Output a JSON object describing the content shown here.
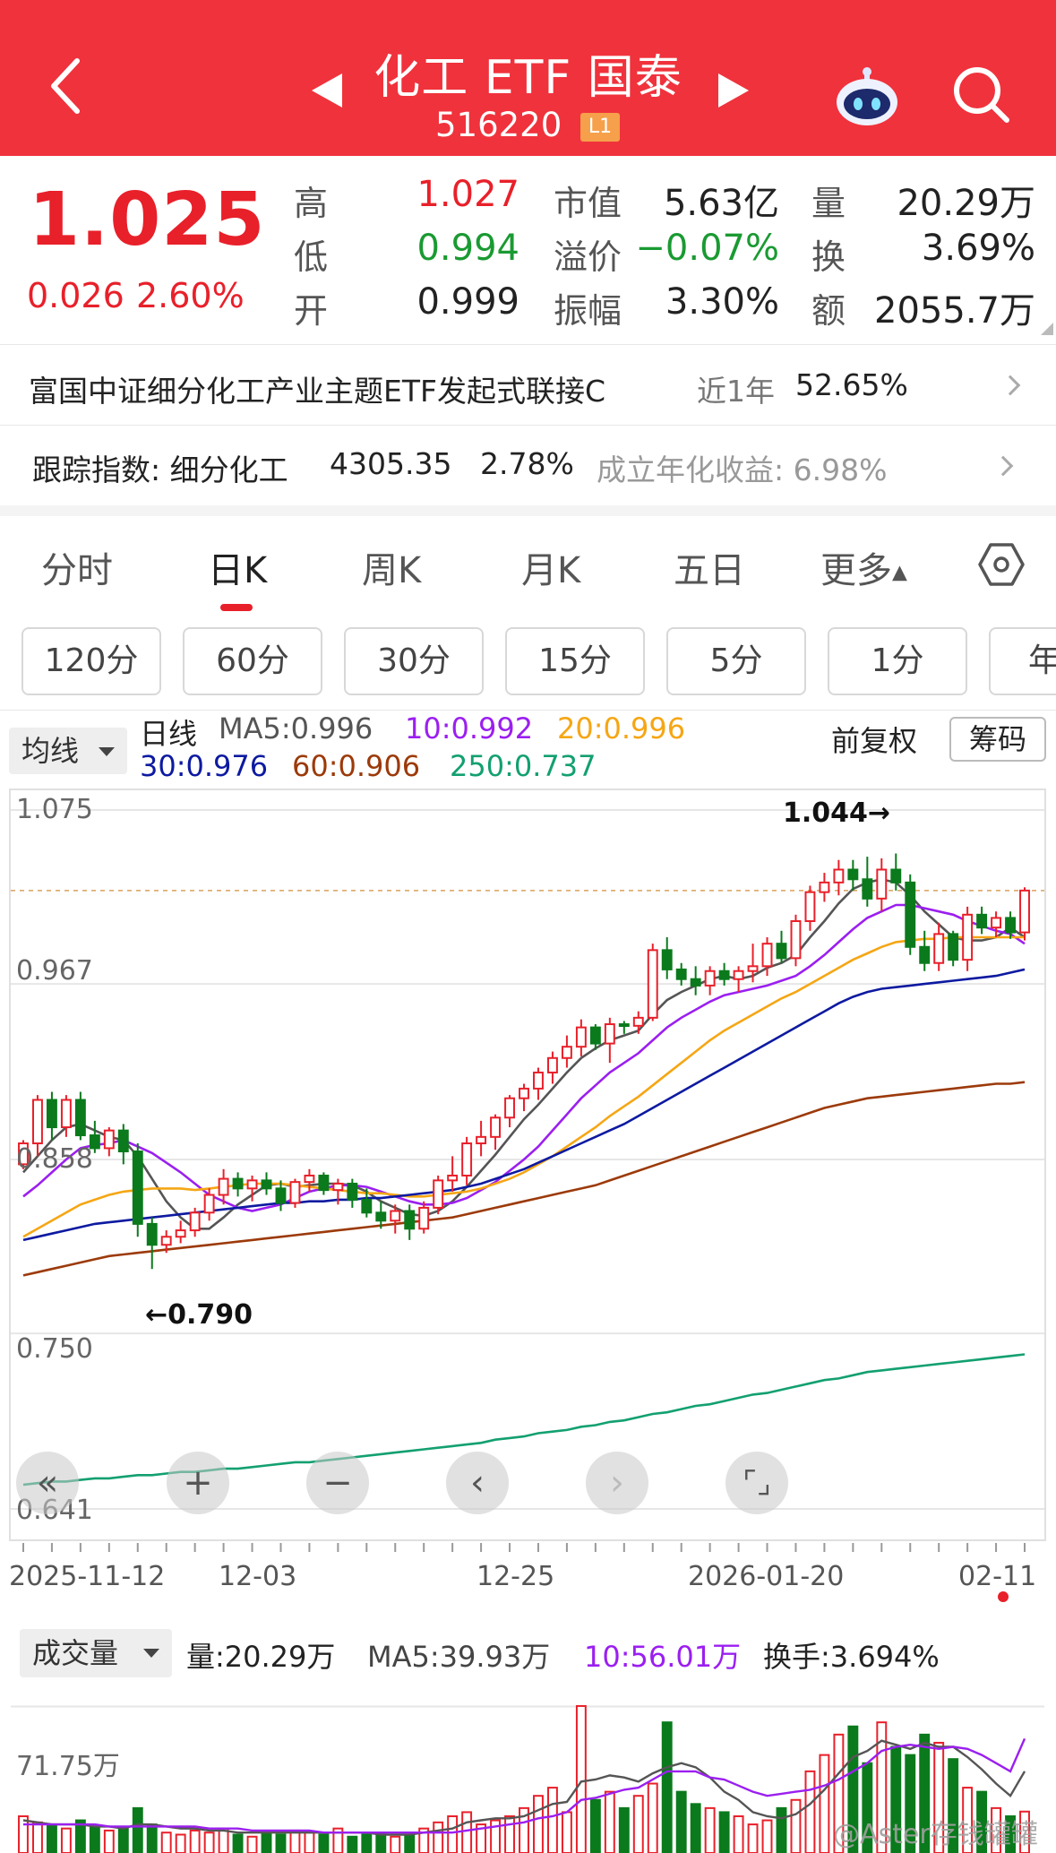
{
  "header": {
    "title": "化工 ETF 国泰",
    "code": "516220",
    "badge": "L1"
  },
  "quote": {
    "price": "1.025",
    "change": "0.026",
    "change_pct": "2.60%",
    "rows": [
      {
        "l1": "高",
        "v1": "1.027",
        "l2": "市值",
        "v2": "5.63亿",
        "l3": "量",
        "v3": "20.29万"
      },
      {
        "l1": "低",
        "v1": "0.994",
        "l2": "溢价",
        "v2": "−0.07%",
        "l3": "换",
        "v3": "3.69%"
      },
      {
        "l1": "开",
        "v1": "0.999",
        "l2": "振幅",
        "v2": "3.30%",
        "l3": "额",
        "v3": "2055.7万"
      }
    ]
  },
  "link_fund": {
    "name": "富国中证细分化工产业主题ETF发起式联接C",
    "period_label": "近1年",
    "period_return": "52.65%"
  },
  "tracking": {
    "label": "跟踪指数: 细分化工",
    "index_value": "4305.35",
    "index_pct": "2.78%",
    "annual_label": "成立年化收益: 6.98%"
  },
  "tabs": [
    "分时",
    "日K",
    "周K",
    "月K",
    "五日",
    "更多"
  ],
  "intervals": [
    "120分",
    "60分",
    "30分",
    "15分",
    "5分",
    "1分",
    "年"
  ],
  "ma_legend": {
    "dropdown": "均线",
    "line_label": "日线",
    "ma5": "MA5:0.996",
    "ma10": "10:0.992",
    "ma20": "20:0.996",
    "ma30": "30:0.976",
    "ma60": "60:0.906",
    "ma250": "250:0.737",
    "adjust": "前复权",
    "chips_button": "筹码"
  },
  "price_axis": [
    "1.075",
    "0.967",
    "0.858",
    "0.750",
    "0.641"
  ],
  "annotations": {
    "high": "1.044→",
    "low": "←0.790"
  },
  "date_axis": [
    "2025-11-12",
    "12-03",
    "12-25",
    "2026-01-20",
    "02-11"
  ],
  "volume": {
    "dropdown": "成交量",
    "vol": "量:20.29万",
    "ma5": "MA5:39.93万",
    "ma10": "10:56.01万",
    "turnover": "换手:3.694%",
    "axis_top": "71.75万"
  },
  "watermark": "@Aster存钱罐罐",
  "colors": {
    "header_red": "#f0323c",
    "up": "#e8202a",
    "down": "#0a7a1c",
    "ma5": "#555555",
    "ma10": "#9b1ff0",
    "ma20": "#f5a614",
    "ma30": "#0d1aa0",
    "ma60": "#9c3a0a",
    "ma250": "#13a070"
  },
  "chart_data": {
    "type": "candlestick",
    "ylim": [
      0.641,
      1.075
    ],
    "yticks": [
      1.075,
      0.967,
      0.858,
      0.75,
      0.641
    ],
    "x": [
      "2025-11-12",
      "12-03",
      "12-25",
      "2026-01-20",
      "02-11"
    ],
    "ohlc": [
      [
        0.855,
        0.87,
        0.852,
        0.868
      ],
      [
        0.868,
        0.898,
        0.86,
        0.895
      ],
      [
        0.895,
        0.9,
        0.87,
        0.878
      ],
      [
        0.878,
        0.898,
        0.872,
        0.895
      ],
      [
        0.895,
        0.9,
        0.87,
        0.873
      ],
      [
        0.873,
        0.882,
        0.862,
        0.865
      ],
      [
        0.865,
        0.878,
        0.86,
        0.876
      ],
      [
        0.876,
        0.88,
        0.855,
        0.863
      ],
      [
        0.863,
        0.868,
        0.81,
        0.818
      ],
      [
        0.818,
        0.822,
        0.79,
        0.805
      ],
      [
        0.805,
        0.814,
        0.8,
        0.81
      ],
      [
        0.81,
        0.82,
        0.806,
        0.814
      ],
      [
        0.814,
        0.828,
        0.81,
        0.825
      ],
      [
        0.825,
        0.84,
        0.82,
        0.836
      ],
      [
        0.836,
        0.852,
        0.83,
        0.846
      ],
      [
        0.846,
        0.85,
        0.835,
        0.84
      ],
      [
        0.84,
        0.848,
        0.832,
        0.845
      ],
      [
        0.845,
        0.85,
        0.836,
        0.84
      ],
      [
        0.84,
        0.845,
        0.826,
        0.831
      ],
      [
        0.831,
        0.846,
        0.828,
        0.844
      ],
      [
        0.844,
        0.852,
        0.838,
        0.848
      ],
      [
        0.848,
        0.85,
        0.836,
        0.839
      ],
      [
        0.839,
        0.846,
        0.83,
        0.843
      ],
      [
        0.843,
        0.846,
        0.828,
        0.833
      ],
      [
        0.833,
        0.84,
        0.822,
        0.825
      ],
      [
        0.825,
        0.832,
        0.815,
        0.82
      ],
      [
        0.82,
        0.83,
        0.812,
        0.826
      ],
      [
        0.826,
        0.83,
        0.808,
        0.815
      ],
      [
        0.815,
        0.832,
        0.812,
        0.828
      ],
      [
        0.828,
        0.848,
        0.824,
        0.845
      ],
      [
        0.845,
        0.86,
        0.838,
        0.848
      ],
      [
        0.848,
        0.872,
        0.842,
        0.868
      ],
      [
        0.868,
        0.882,
        0.86,
        0.872
      ],
      [
        0.872,
        0.886,
        0.864,
        0.884
      ],
      [
        0.884,
        0.898,
        0.878,
        0.896
      ],
      [
        0.896,
        0.905,
        0.888,
        0.902
      ],
      [
        0.902,
        0.915,
        0.895,
        0.912
      ],
      [
        0.912,
        0.925,
        0.905,
        0.921
      ],
      [
        0.921,
        0.935,
        0.915,
        0.928
      ],
      [
        0.928,
        0.945,
        0.922,
        0.94
      ],
      [
        0.94,
        0.942,
        0.926,
        0.93
      ],
      [
        0.93,
        0.946,
        0.918,
        0.942
      ],
      [
        0.942,
        0.944,
        0.936,
        0.941
      ],
      [
        0.941,
        0.95,
        0.936,
        0.946
      ],
      [
        0.946,
        0.992,
        0.944,
        0.988
      ],
      [
        0.988,
        0.996,
        0.97,
        0.976
      ],
      [
        0.976,
        0.98,
        0.966,
        0.97
      ],
      [
        0.97,
        0.978,
        0.96,
        0.966
      ],
      [
        0.966,
        0.978,
        0.96,
        0.975
      ],
      [
        0.975,
        0.98,
        0.966,
        0.97
      ],
      [
        0.97,
        0.978,
        0.962,
        0.975
      ],
      [
        0.975,
        0.992,
        0.968,
        0.978
      ],
      [
        0.978,
        0.996,
        0.972,
        0.992
      ],
      [
        0.992,
        1.0,
        0.98,
        0.983
      ],
      [
        0.983,
        1.01,
        0.978,
        1.006
      ],
      [
        1.006,
        1.028,
        1.0,
        1.024
      ],
      [
        1.024,
        1.036,
        1.018,
        1.03
      ],
      [
        1.03,
        1.044,
        1.022,
        1.038
      ],
      [
        1.038,
        1.044,
        1.025,
        1.032
      ],
      [
        1.032,
        1.046,
        1.015,
        1.02
      ],
      [
        1.02,
        1.045,
        1.012,
        1.038
      ],
      [
        1.038,
        1.048,
        1.025,
        1.03
      ],
      [
        1.03,
        1.035,
        0.985,
        0.99
      ],
      [
        0.99,
        1.0,
        0.975,
        0.98
      ],
      [
        0.98,
        1.005,
        0.975,
        0.998
      ],
      [
        0.998,
        1.0,
        0.978,
        0.982
      ],
      [
        0.982,
        1.015,
        0.975,
        1.01
      ],
      [
        1.01,
        1.015,
        0.998,
        1.002
      ],
      [
        1.002,
        1.012,
        0.996,
        1.008
      ],
      [
        1.008,
        1.012,
        0.995,
        0.999
      ],
      [
        0.999,
        1.027,
        0.994,
        1.025
      ]
    ],
    "series": [
      {
        "name": "MA5",
        "values": [
          0.85,
          0.86,
          0.87,
          0.878,
          0.88,
          0.876,
          0.872,
          0.87,
          0.86,
          0.846,
          0.832,
          0.822,
          0.815,
          0.815,
          0.822,
          0.83,
          0.836,
          0.842,
          0.843,
          0.841,
          0.842,
          0.843,
          0.843,
          0.842,
          0.838,
          0.832,
          0.828,
          0.824,
          0.823,
          0.826,
          0.832,
          0.841,
          0.851,
          0.861,
          0.872,
          0.883,
          0.892,
          0.902,
          0.912,
          0.921,
          0.927,
          0.932,
          0.935,
          0.938,
          0.948,
          0.957,
          0.962,
          0.966,
          0.97,
          0.972,
          0.97,
          0.972,
          0.977,
          0.98,
          0.985,
          0.996,
          1.006,
          1.017,
          1.026,
          1.03,
          1.032,
          1.03,
          1.022,
          1.012,
          1.004,
          0.996,
          0.994,
          0.994,
          0.996,
          1.002,
          0.996
        ]
      },
      {
        "name": "MA10",
        "values": [
          0.835,
          0.842,
          0.85,
          0.858,
          0.865,
          0.867,
          0.868,
          0.87,
          0.866,
          0.862,
          0.856,
          0.85,
          0.843,
          0.836,
          0.832,
          0.828,
          0.826,
          0.828,
          0.83,
          0.834,
          0.838,
          0.84,
          0.842,
          0.842,
          0.841,
          0.838,
          0.835,
          0.832,
          0.83,
          0.83,
          0.831,
          0.834,
          0.839,
          0.844,
          0.851,
          0.858,
          0.866,
          0.876,
          0.886,
          0.896,
          0.904,
          0.912,
          0.918,
          0.924,
          0.932,
          0.94,
          0.946,
          0.951,
          0.956,
          0.96,
          0.962,
          0.964,
          0.966,
          0.969,
          0.972,
          0.978,
          0.985,
          0.993,
          1.001,
          1.008,
          1.012,
          1.016,
          1.016,
          1.014,
          1.012,
          1.01,
          1.006,
          1.003,
          1.0,
          0.998,
          0.992
        ]
      },
      {
        "name": "MA20",
        "values": [
          0.81,
          0.815,
          0.82,
          0.825,
          0.83,
          0.833,
          0.836,
          0.838,
          0.839,
          0.84,
          0.84,
          0.84,
          0.839,
          0.84,
          0.841,
          0.842,
          0.843,
          0.843,
          0.843,
          0.842,
          0.841,
          0.84,
          0.839,
          0.838,
          0.837,
          0.837,
          0.836,
          0.835,
          0.835,
          0.836,
          0.837,
          0.838,
          0.84,
          0.843,
          0.846,
          0.85,
          0.855,
          0.86,
          0.866,
          0.872,
          0.878,
          0.885,
          0.891,
          0.897,
          0.904,
          0.911,
          0.918,
          0.925,
          0.932,
          0.938,
          0.943,
          0.948,
          0.953,
          0.958,
          0.962,
          0.967,
          0.972,
          0.977,
          0.982,
          0.986,
          0.99,
          0.993,
          0.994,
          0.995,
          0.995,
          0.996,
          0.996,
          0.996,
          0.996,
          0.996,
          0.996
        ]
      },
      {
        "name": "MA30",
        "values": [
          0.808,
          0.81,
          0.812,
          0.814,
          0.816,
          0.818,
          0.819,
          0.82,
          0.821,
          0.822,
          0.823,
          0.824,
          0.825,
          0.826,
          0.827,
          0.828,
          0.829,
          0.83,
          0.831,
          0.831,
          0.832,
          0.832,
          0.833,
          0.833,
          0.834,
          0.834,
          0.835,
          0.836,
          0.837,
          0.838,
          0.839,
          0.841,
          0.843,
          0.846,
          0.849,
          0.852,
          0.856,
          0.86,
          0.864,
          0.868,
          0.872,
          0.876,
          0.88,
          0.885,
          0.89,
          0.895,
          0.9,
          0.905,
          0.91,
          0.915,
          0.92,
          0.925,
          0.93,
          0.935,
          0.94,
          0.945,
          0.95,
          0.955,
          0.959,
          0.962,
          0.964,
          0.965,
          0.966,
          0.967,
          0.968,
          0.969,
          0.97,
          0.971,
          0.972,
          0.974,
          0.976
        ]
      },
      {
        "name": "MA60",
        "values": [
          0.786,
          0.788,
          0.79,
          0.792,
          0.794,
          0.796,
          0.798,
          0.799,
          0.8,
          0.801,
          0.802,
          0.803,
          0.804,
          0.805,
          0.806,
          0.807,
          0.808,
          0.809,
          0.81,
          0.811,
          0.812,
          0.813,
          0.814,
          0.815,
          0.816,
          0.817,
          0.818,
          0.819,
          0.82,
          0.821,
          0.822,
          0.824,
          0.826,
          0.828,
          0.83,
          0.832,
          0.834,
          0.836,
          0.838,
          0.84,
          0.842,
          0.845,
          0.848,
          0.851,
          0.854,
          0.857,
          0.86,
          0.863,
          0.866,
          0.869,
          0.872,
          0.875,
          0.878,
          0.881,
          0.884,
          0.887,
          0.89,
          0.892,
          0.894,
          0.896,
          0.897,
          0.898,
          0.899,
          0.9,
          0.901,
          0.902,
          0.903,
          0.904,
          0.905,
          0.905,
          0.906
        ]
      },
      {
        "name": "MA250",
        "values": [
          0.656,
          0.657,
          0.658,
          0.658,
          0.659,
          0.66,
          0.66,
          0.661,
          0.662,
          0.662,
          0.663,
          0.664,
          0.664,
          0.665,
          0.666,
          0.666,
          0.667,
          0.668,
          0.669,
          0.67,
          0.67,
          0.671,
          0.672,
          0.673,
          0.674,
          0.675,
          0.676,
          0.677,
          0.678,
          0.679,
          0.68,
          0.681,
          0.682,
          0.684,
          0.685,
          0.686,
          0.688,
          0.689,
          0.69,
          0.692,
          0.693,
          0.695,
          0.696,
          0.698,
          0.7,
          0.701,
          0.703,
          0.705,
          0.706,
          0.708,
          0.71,
          0.712,
          0.713,
          0.715,
          0.717,
          0.719,
          0.721,
          0.722,
          0.724,
          0.726,
          0.727,
          0.728,
          0.729,
          0.73,
          0.731,
          0.732,
          0.733,
          0.734,
          0.735,
          0.736,
          0.737
        ]
      }
    ],
    "volume_ylim": [
      0,
      79
    ],
    "volume": [
      18,
      15,
      14,
      12,
      16,
      13,
      11,
      12,
      22,
      14,
      10,
      9,
      11,
      10,
      12,
      9,
      8,
      10,
      9,
      11,
      10,
      9,
      12,
      8,
      9,
      10,
      8,
      9,
      12,
      15,
      18,
      20,
      14,
      16,
      18,
      22,
      28,
      32,
      20,
      72,
      26,
      30,
      22,
      28,
      34,
      64,
      30,
      24,
      22,
      20,
      18,
      14,
      16,
      22,
      26,
      40,
      48,
      58,
      62,
      44,
      64,
      52,
      48,
      58,
      54,
      46,
      32,
      30,
      22,
      18,
      20.29
    ],
    "volume_series": [
      {
        "name": "MA5",
        "values": [
          16,
          15,
          14,
          14,
          14,
          13,
          13,
          12,
          14,
          14,
          13,
          12,
          12,
          11,
          11,
          10,
          10,
          10,
          10,
          10,
          10,
          10,
          10,
          10,
          10,
          9,
          9,
          9,
          10,
          11,
          12,
          15,
          16,
          17,
          17,
          18,
          21,
          24,
          25,
          35,
          36,
          38,
          37,
          35,
          39,
          42,
          44,
          42,
          37,
          30,
          26,
          20,
          18,
          17,
          19,
          24,
          31,
          39,
          47,
          50,
          55,
          53,
          51,
          54,
          52,
          52,
          47,
          41,
          34,
          28,
          40
        ]
      },
      {
        "name": "MA10",
        "values": [
          14,
          14,
          14,
          14,
          14,
          14,
          13,
          13,
          13,
          13,
          13,
          13,
          13,
          12,
          12,
          12,
          11,
          11,
          11,
          11,
          11,
          10,
          10,
          10,
          10,
          10,
          10,
          10,
          10,
          10,
          10,
          11,
          12,
          13,
          14,
          15,
          17,
          18,
          20,
          26,
          27,
          29,
          31,
          32,
          36,
          40,
          40,
          40,
          37,
          36,
          33,
          30,
          28,
          29,
          30,
          31,
          33,
          36,
          40,
          44,
          50,
          52,
          53,
          52,
          51,
          52,
          51,
          48,
          44,
          40,
          56
        ]
      }
    ]
  }
}
